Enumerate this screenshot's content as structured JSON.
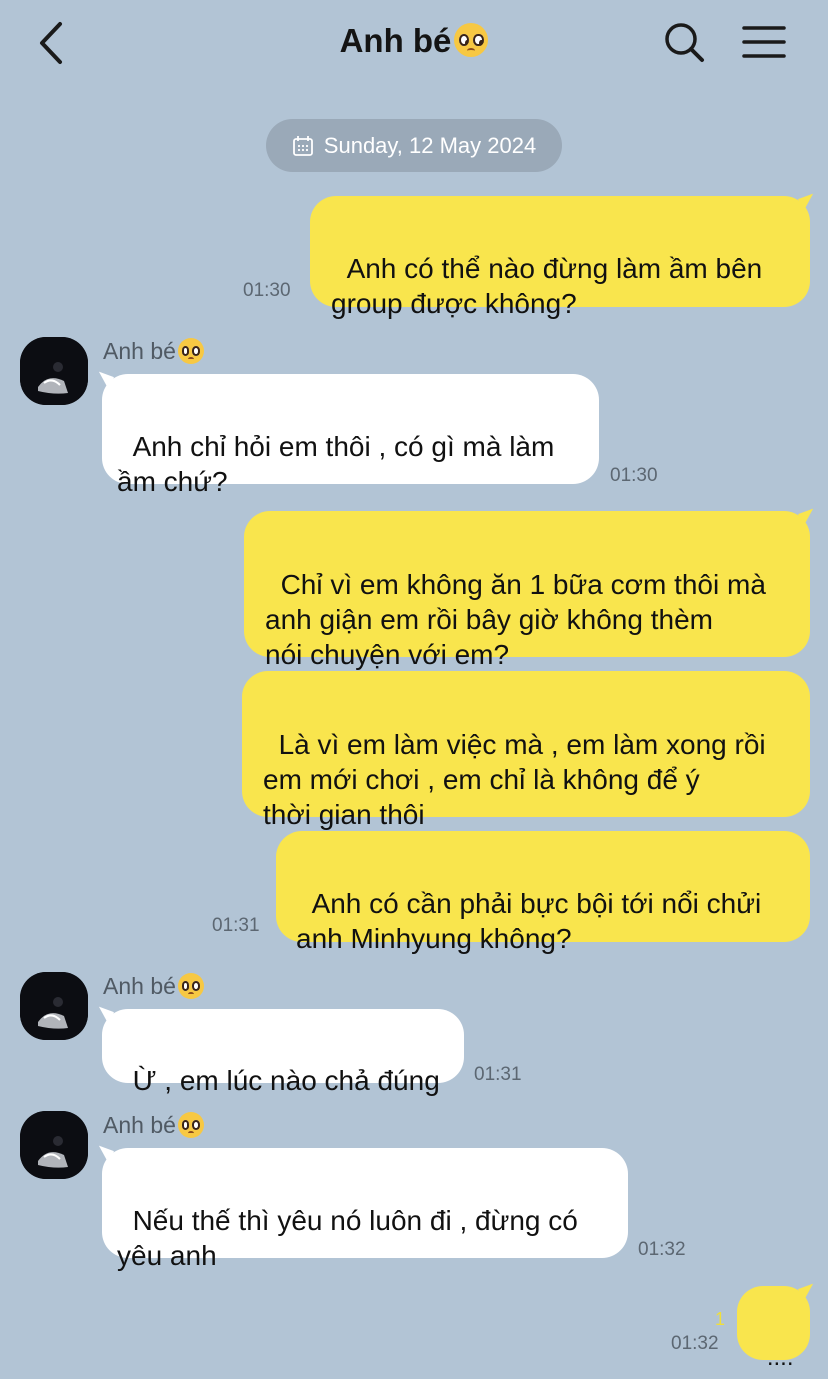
{
  "header": {
    "title": "Anh bé"
  },
  "date_divider": "Sunday, 12 May 2024",
  "messages": [
    {
      "from": "me",
      "text": "Anh có thể nào đừng làm ầm bên\ngroup được không?",
      "time": "01:30"
    },
    {
      "from": "them",
      "sender": "Anh bé",
      "text": "Anh chỉ hỏi em thôi , có gì mà làm\nầm chứ?",
      "time": "01:30"
    },
    {
      "from": "me",
      "text": "Chỉ vì em không ăn 1 bữa cơm thôi mà\nanh giận em rồi bây giờ không thèm\nnói chuyện với em?"
    },
    {
      "from": "me",
      "text": "Là vì em làm việc mà , em làm xong rồi\nem mới chơi , em chỉ là không để ý\nthời gian thôi"
    },
    {
      "from": "me",
      "text": "Anh có cần phải bực bội tới nổi chửi\nanh Minhyung không?",
      "time": "01:31"
    },
    {
      "from": "them",
      "sender": "Anh bé",
      "text": "Ừ , em lúc nào chả đúng",
      "time": "01:31"
    },
    {
      "from": "them",
      "sender": "Anh bé",
      "text": "Nếu thế thì yêu nó luôn đi , đừng có\nyêu anh",
      "time": "01:32"
    },
    {
      "from": "me",
      "text": "....",
      "time": "01:32",
      "unread": "1"
    }
  ],
  "icons": [
    "back-arrow-icon",
    "search-icon",
    "menu-icon",
    "calendar-icon",
    "pleading-face-emoji"
  ],
  "colors": {
    "background": "#b2c4d5",
    "my_bubble": "#f9e54d",
    "their_bubble": "#ffffff",
    "date_pill": "#9aa9b8"
  }
}
